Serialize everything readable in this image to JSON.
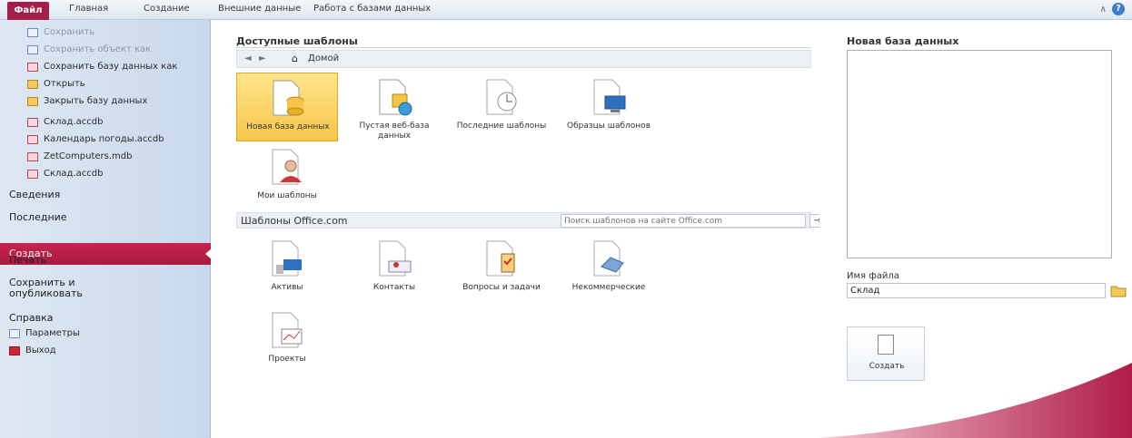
{
  "ribbon": {
    "file_tab": "Файл",
    "tabs": [
      "Главная",
      "Создание",
      "Внешние данные",
      "Работа с базами данных"
    ],
    "right_mini": "∧"
  },
  "nav": {
    "items": [
      {
        "label": "Сохранить",
        "disabled": true
      },
      {
        "label": "Сохранить объект как",
        "disabled": true
      },
      {
        "label": "Сохранить базу данных как",
        "disabled": false
      },
      {
        "label": "Открыть",
        "disabled": false
      },
      {
        "label": "Закрыть базу данных",
        "disabled": false
      }
    ],
    "recent": [
      "Склад.accdb",
      "Календарь погоды.accdb",
      "ZetComputers.mdb",
      "Склад.accdb"
    ],
    "sections": [
      "Сведения",
      "Последние",
      "Создать",
      "Печать",
      "Сохранить и опубликовать",
      "Справка"
    ],
    "bottom": [
      "Параметры",
      "Выход"
    ]
  },
  "center": {
    "available_title": "Доступные шаблоны",
    "breadcrumb_home": "Домой",
    "tiles": [
      "Новая база данных",
      "Пустая веб-база данных",
      "Последние шаблоны",
      "Образцы шаблонов",
      "Мои шаблоны"
    ],
    "office_title": "Шаблоны Office.com",
    "office_search_placeholder": "Поиск шаблонов на сайте Office.com",
    "office_tiles": [
      "Активы",
      "Контакты",
      "Вопросы и задачи",
      "Некоммерческие",
      "Проекты"
    ]
  },
  "right": {
    "title": "Новая база данных",
    "filename_label": "Имя файла",
    "filename_value": "Склад",
    "create_label": "Создать"
  },
  "colors": {
    "accent": "#a41f47",
    "nav_bg": "#d4e1f0",
    "selected_tile": "#f8c64a"
  }
}
